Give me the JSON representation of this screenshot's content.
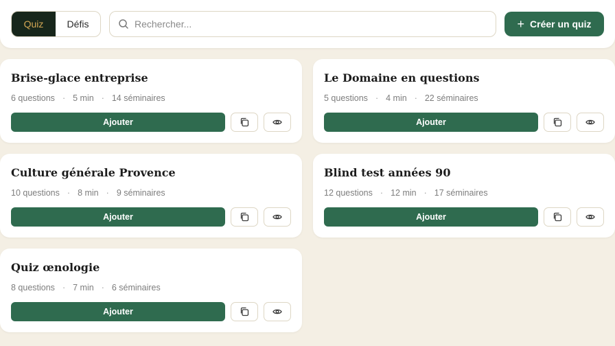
{
  "header": {
    "tabs": [
      {
        "label": "Quiz",
        "active": true
      },
      {
        "label": "Défis",
        "active": false
      }
    ],
    "search": {
      "placeholder": "Rechercher...",
      "icon": "search-icon"
    },
    "create_button": {
      "label": "Créer un quiz",
      "icon": "plus-icon"
    }
  },
  "colors": {
    "background": "#f4efe4",
    "primary": "#2f6b4f",
    "active_tab_bg": "#17261b",
    "active_tab_text": "#d3a754"
  },
  "cards": [
    {
      "title": "Brise-glace entreprise",
      "questions": "6 questions",
      "duration": "5 min",
      "seminars": "14 séminaires",
      "add_label": "Ajouter"
    },
    {
      "title": "Le Domaine en questions",
      "questions": "5 questions",
      "duration": "4 min",
      "seminars": "22 séminaires",
      "add_label": "Ajouter"
    },
    {
      "title": "Culture générale Provence",
      "questions": "10 questions",
      "duration": "8 min",
      "seminars": "9 séminaires",
      "add_label": "Ajouter"
    },
    {
      "title": "Blind test années 90",
      "questions": "12 questions",
      "duration": "12 min",
      "seminars": "17 séminaires",
      "add_label": "Ajouter"
    },
    {
      "title": "Quiz œnologie",
      "questions": "8 questions",
      "duration": "7 min",
      "seminars": "6 séminaires",
      "add_label": "Ajouter"
    }
  ],
  "meta_separator": "·"
}
